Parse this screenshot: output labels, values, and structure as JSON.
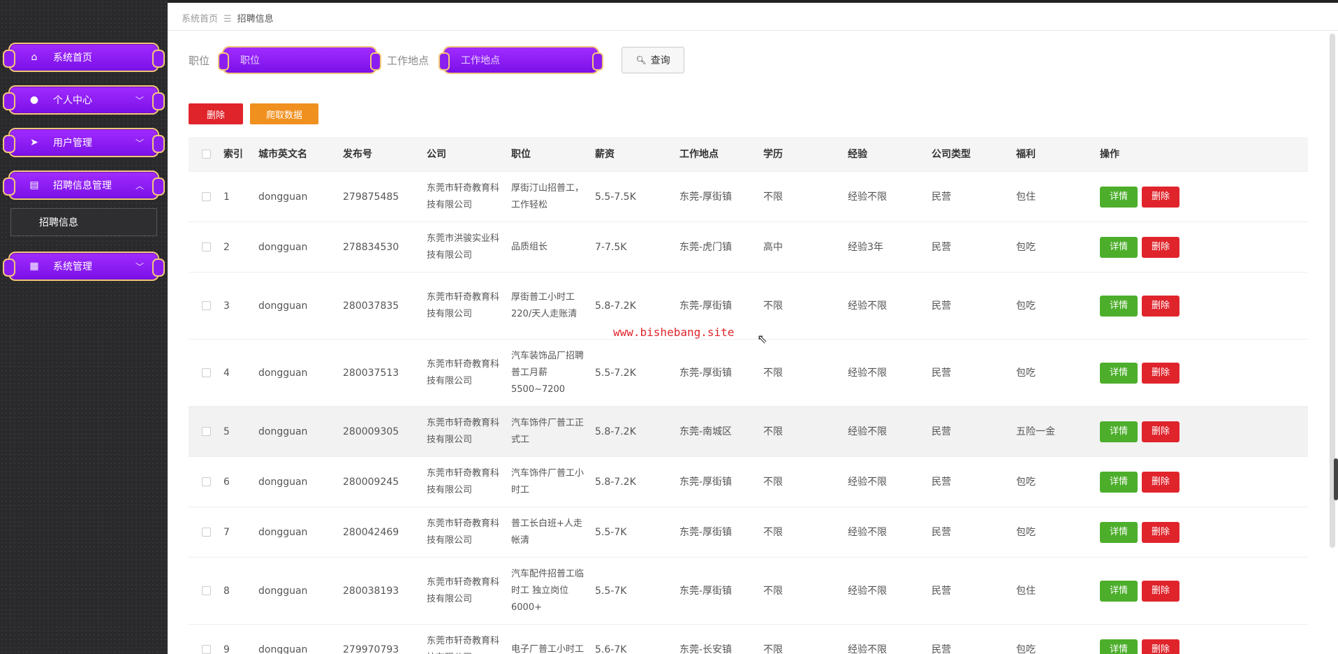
{
  "breadcrumb": {
    "home": "系统首页",
    "sep": "☰",
    "current": "招聘信息"
  },
  "sidebar": {
    "items": [
      {
        "label": "系统首页",
        "icon": "home-icon",
        "expandable": false
      },
      {
        "label": "个人中心",
        "icon": "user-icon",
        "expandable": true
      },
      {
        "label": "用户管理",
        "icon": "send-icon",
        "expandable": true
      },
      {
        "label": "招聘信息管理",
        "icon": "chart-icon",
        "expandable": true,
        "expanded": true
      },
      {
        "label": "系统管理",
        "icon": "grid-icon",
        "expandable": true
      }
    ],
    "submenu": {
      "label": "招聘信息"
    }
  },
  "search": {
    "position_label": "职位",
    "position_placeholder": "职位",
    "location_label": "工作地点",
    "location_placeholder": "工作地点",
    "query_label": "查询"
  },
  "toolbar": {
    "delete_label": "删除",
    "crawl_label": "爬取数据"
  },
  "table": {
    "headers": [
      "索引",
      "城市英文名",
      "发布号",
      "公司",
      "职位",
      "薪资",
      "工作地点",
      "学历",
      "经验",
      "公司类型",
      "福利",
      "操作"
    ],
    "detail_label": "详情",
    "delete_label": "删除",
    "rows": [
      {
        "index": "1",
        "city": "dongguan",
        "pub": "279875485",
        "company": "东莞市轩奇教育科技有限公司",
        "position": "厚街汀山招普工，工作轻松",
        "salary": "5.5-7.5K",
        "location": "东莞-厚街镇",
        "edu": "不限",
        "exp": "经验不限",
        "type": "民营",
        "welfare": "包住"
      },
      {
        "index": "2",
        "city": "dongguan",
        "pub": "278834530",
        "company": "东莞市洪骏实业科技有限公司",
        "position": "品质组长",
        "salary": "7-7.5K",
        "location": "东莞-虎门镇",
        "edu": "高中",
        "exp": "经验3年",
        "type": "民营",
        "welfare": "包吃"
      },
      {
        "index": "3",
        "city": "dongguan",
        "pub": "280037835",
        "company": "东莞市轩奇教育科技有限公司",
        "position": "厚街普工小时工220/天人走账清",
        "salary": "5.8-7.2K",
        "location": "东莞-厚街镇",
        "edu": "不限",
        "exp": "经验不限",
        "type": "民营",
        "welfare": "包吃"
      },
      {
        "index": "4",
        "city": "dongguan",
        "pub": "280037513",
        "company": "东莞市轩奇教育科技有限公司",
        "position": "汽车装饰品厂招聘普工月薪5500~7200",
        "salary": "5.5-7.2K",
        "location": "东莞-厚街镇",
        "edu": "不限",
        "exp": "经验不限",
        "type": "民营",
        "welfare": "包吃"
      },
      {
        "index": "5",
        "city": "dongguan",
        "pub": "280009305",
        "company": "东莞市轩奇教育科技有限公司",
        "position": "汽车饰件厂普工正式工",
        "salary": "5.8-7.2K",
        "location": "东莞-南城区",
        "edu": "不限",
        "exp": "经验不限",
        "type": "民营",
        "welfare": "五险一金"
      },
      {
        "index": "6",
        "city": "dongguan",
        "pub": "280009245",
        "company": "东莞市轩奇教育科技有限公司",
        "position": "汽车饰件厂普工小时工",
        "salary": "5.8-7.2K",
        "location": "东莞-厚街镇",
        "edu": "不限",
        "exp": "经验不限",
        "type": "民营",
        "welfare": "包吃"
      },
      {
        "index": "7",
        "city": "dongguan",
        "pub": "280042469",
        "company": "东莞市轩奇教育科技有限公司",
        "position": "普工长白班+人走帐清",
        "salary": "5.5-7K",
        "location": "东莞-厚街镇",
        "edu": "不限",
        "exp": "经验不限",
        "type": "民营",
        "welfare": "包吃"
      },
      {
        "index": "8",
        "city": "dongguan",
        "pub": "280038193",
        "company": "东莞市轩奇教育科技有限公司",
        "position": "汽车配件招普工临时工 独立岗位6000+",
        "salary": "5.5-7K",
        "location": "东莞-厚街镇",
        "edu": "不限",
        "exp": "经验不限",
        "type": "民营",
        "welfare": "包住"
      },
      {
        "index": "9",
        "city": "dongguan",
        "pub": "279970793",
        "company": "东莞市轩奇教育科技有限公司",
        "position": "电子厂普工小时工",
        "salary": "5.6-7K",
        "location": "东莞-长安镇",
        "edu": "不限",
        "exp": "经验不限",
        "type": "民营",
        "welfare": "包吃"
      }
    ]
  },
  "watermark": "www.bishebang.site"
}
